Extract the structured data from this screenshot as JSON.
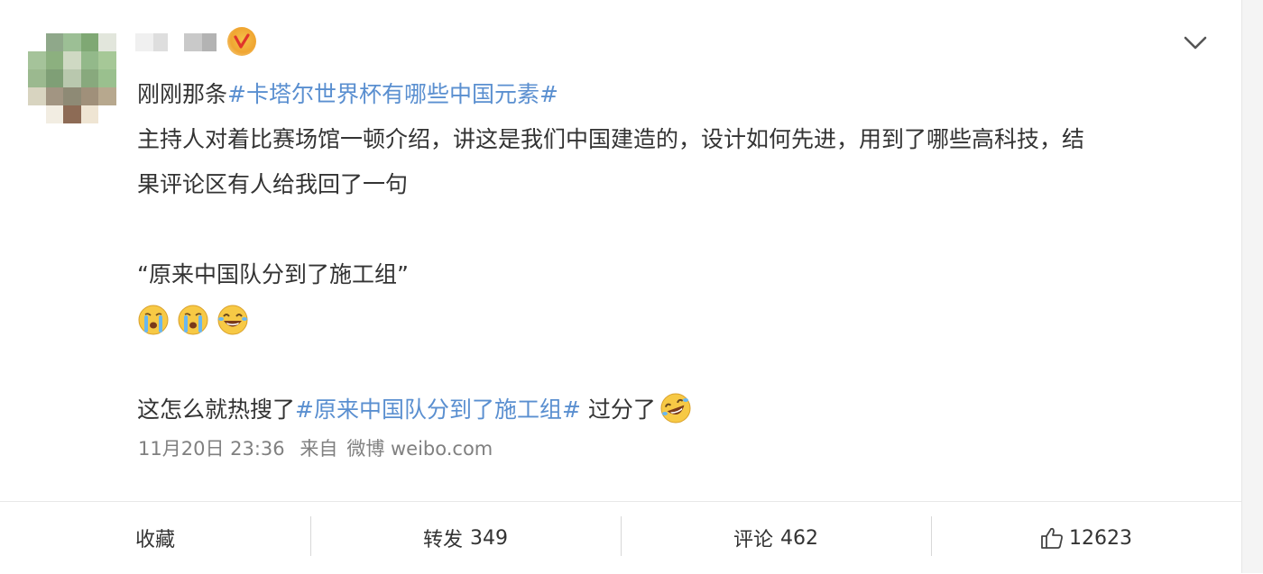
{
  "post": {
    "hashtag_title": "#卡塔尔世界杯有哪些中国元素#",
    "title_prefix": "刚刚那条",
    "body_line1": "主持人对着比赛场馆一顿介绍，讲这是我们中国建造的，设计如何先进，用到了哪些高科技，结",
    "body_line2": "果评论区有人给我回了一句",
    "quote": "“原来中国队分到了施工组”",
    "closing_prefix": "这怎么就热搜了",
    "closing_hashtag": "#原来中国队分到了施工组#",
    "closing_suffix": " 过分了",
    "emojis": [
      "crying-face",
      "crying-face",
      "laughing-tears-face"
    ],
    "closing_emoji": "rolling-laughing-face"
  },
  "meta": {
    "date": "11月20日 23:36",
    "from_label": "来自",
    "source": "微博 weibo.com"
  },
  "actions": {
    "favorite_label": "收藏",
    "repost_label": "转发",
    "repost_count": "349",
    "comment_label": "评论",
    "comment_count": "462",
    "like_count": "12623"
  },
  "colors": {
    "hashtag": "#5a8fd0",
    "meta_text": "#808080",
    "vip_badge": "#f0a531"
  }
}
